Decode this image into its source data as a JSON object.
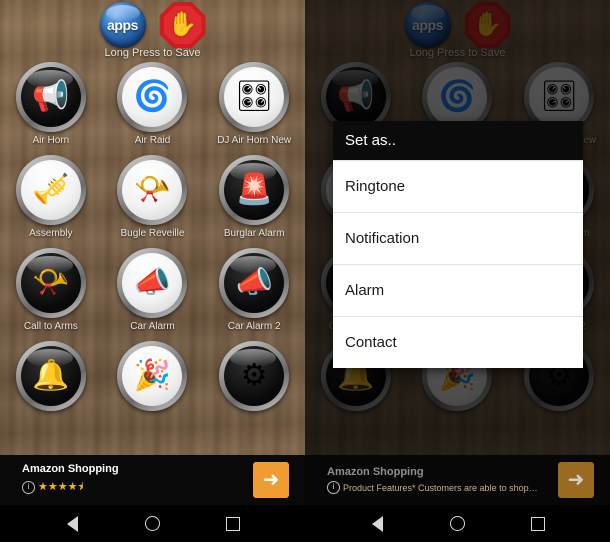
{
  "app": {
    "header": {
      "apps_label": "apps",
      "stop_icon": "stop-hand",
      "hint": "Long Press to Save"
    },
    "sounds": [
      {
        "label": "Air Horn",
        "glyph": "📢",
        "tone": "dark"
      },
      {
        "label": "Air Raid",
        "glyph": "🌀",
        "tone": "light"
      },
      {
        "label": "DJ Air Horn New",
        "glyph": "🎛",
        "tone": "light"
      },
      {
        "label": "Assembly",
        "glyph": "🎺",
        "tone": "light"
      },
      {
        "label": "Bugle Reveille",
        "glyph": "📯",
        "tone": "light"
      },
      {
        "label": "Burglar Alarm",
        "glyph": "🚨",
        "tone": "dark"
      },
      {
        "label": "Call to Arms",
        "glyph": "📯",
        "tone": "dark"
      },
      {
        "label": "Car Alarm",
        "glyph": "📣",
        "tone": "light"
      },
      {
        "label": "Car Alarm 2",
        "glyph": "📣",
        "tone": "dark"
      }
    ],
    "partial_row": [
      {
        "glyph": "🔔",
        "tone": "dark"
      },
      {
        "glyph": "🎉",
        "tone": "light"
      },
      {
        "glyph": "⚙",
        "tone": "dark"
      }
    ]
  },
  "dialog": {
    "title": "Set as..",
    "options": [
      {
        "label": "Ringtone"
      },
      {
        "label": "Notification"
      },
      {
        "label": "Alarm"
      },
      {
        "label": "Contact"
      }
    ]
  },
  "ads": {
    "left": {
      "title": "Amazon Shopping",
      "stars": "★★★★⯨",
      "info_glyph": "i",
      "cta_glyph": "➜"
    },
    "right": {
      "title": "Amazon Shopping",
      "description": "Product Features* Customers are able to shop…",
      "info_glyph": "i",
      "cta_glyph": "➜"
    }
  },
  "navbar": {
    "back_label": "back",
    "home_label": "home",
    "recents_label": "recents"
  },
  "colors": {
    "wood": "#7d6348",
    "accent_orange": "#ef9d32",
    "dialog_header": "#0b0b0b",
    "star_gold": "#f0b429"
  }
}
